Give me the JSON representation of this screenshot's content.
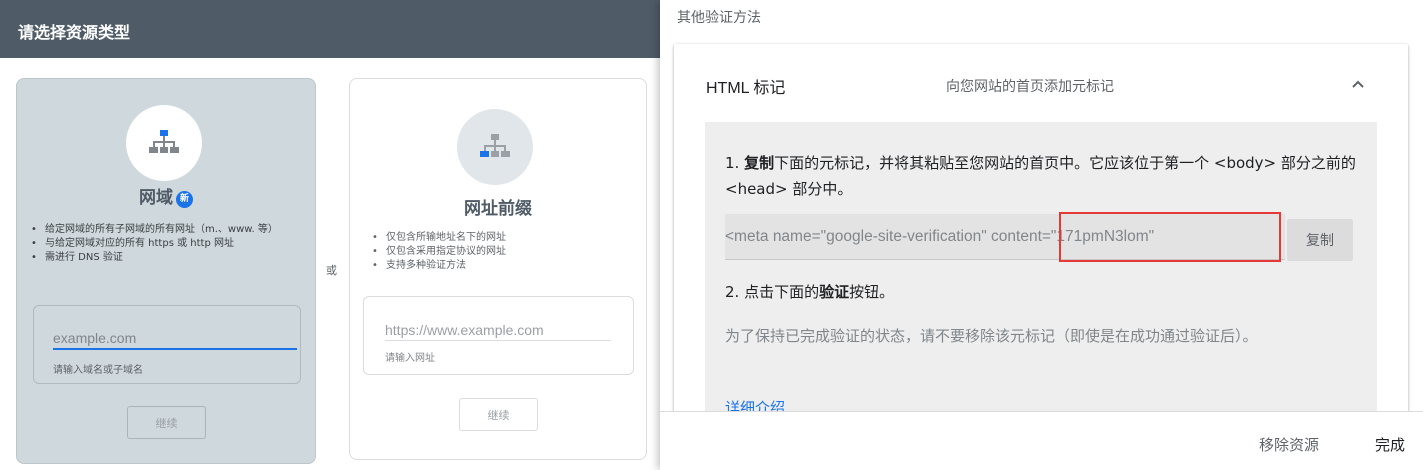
{
  "left": {
    "header_title": "请选择资源类型",
    "or_label": "或",
    "domain": {
      "title": "网域",
      "badge": "新",
      "bullets": [
        "给定网域的所有子网域的所有网址（m.、www. 等）",
        "与给定网域对应的所有 https 或 http 网址",
        "需进行 DNS 验证"
      ],
      "input_placeholder": "example.com",
      "input_help": "请输入域名或子域名",
      "continue_label": "继续"
    },
    "prefix": {
      "title": "网址前缀",
      "bullets": [
        "仅包含所输地址名下的网址",
        "仅包含采用指定协议的网址",
        "支持多种验证方法"
      ],
      "input_placeholder": "https://www.example.com",
      "input_help": "请输入网址",
      "continue_label": "继续"
    }
  },
  "dialog": {
    "heading": "其他验证方法",
    "method": {
      "title": "HTML 标记",
      "description": "向您网站的首页添加元标记",
      "step1_prefix": "1. ",
      "step1_bold": "复制",
      "step1_rest": "下面的元标记，并将其粘贴至您网站的首页中。它应该位于第一个 <body> 部分之前的 <head> 部分中。",
      "meta_tag": "<meta name=\"google-site-verification\" content=\"171pmN3lom\"",
      "copy_label": "复制",
      "step2_prefix": "2. 点击下面的",
      "step2_bold": "验证",
      "step2_rest": "按钮。",
      "note": "为了保持已完成验证的状态，请不要移除该元标记（即使是在成功通过验证后）。",
      "details_link": "详细介绍"
    },
    "footer": {
      "remove_label": "移除资源",
      "done_label": "完成"
    }
  },
  "colors": {
    "header_bg": "#4f5b67",
    "selected_card_bg": "#cfd8dc",
    "accent_blue": "#1a73e8",
    "highlight_red": "#e53935"
  },
  "icons": [
    "sitemap-icon",
    "chevron-up-icon"
  ]
}
